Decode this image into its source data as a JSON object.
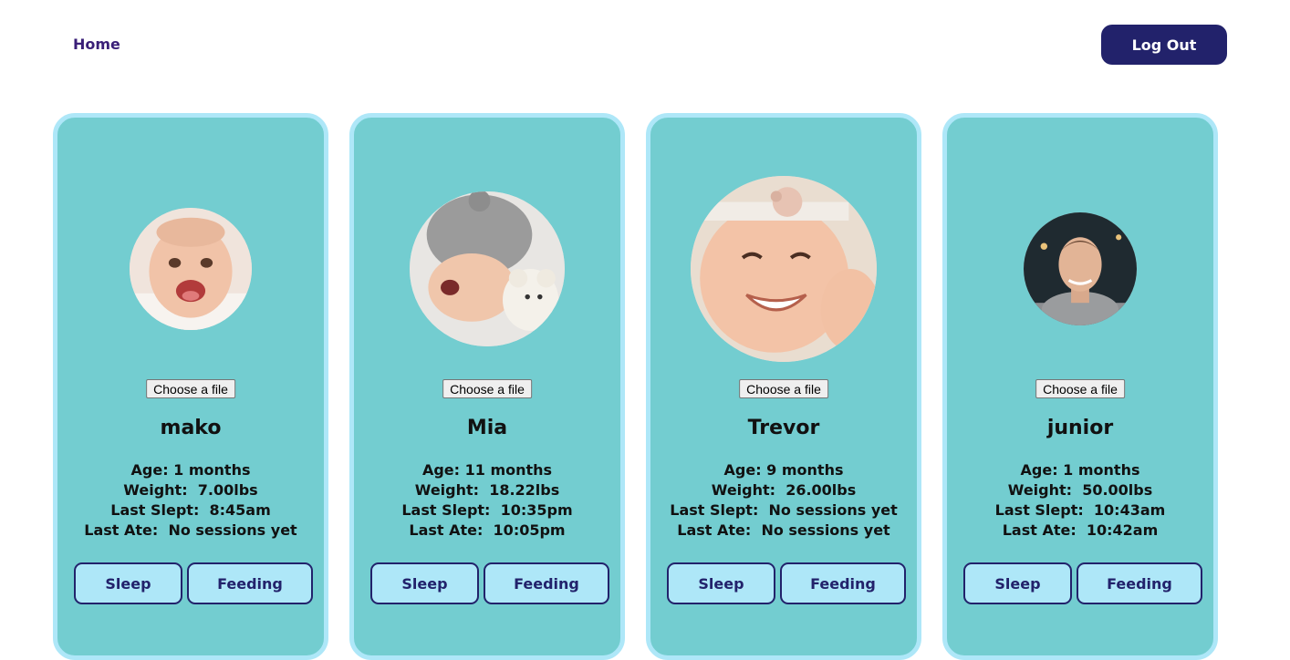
{
  "nav": {
    "home_label": "Home",
    "logout_label": "Log Out"
  },
  "file_button_label": "Choose a file",
  "actions": {
    "sleep_label": "Sleep",
    "feeding_label": "Feeding"
  },
  "babies": [
    {
      "name": "mako",
      "stats": [
        {
          "label": "Age:",
          "value": "1 months",
          "sep": " "
        },
        {
          "label": "Weight:",
          "value": "7.00lbs",
          "sep": "  "
        },
        {
          "label": "Last Slept:",
          "value": "8:45am",
          "sep": "  "
        },
        {
          "label": "Last Ate:",
          "value": "No sessions yet",
          "sep": "  "
        }
      ]
    },
    {
      "name": "Mia",
      "stats": [
        {
          "label": "Age:",
          "value": "11 months",
          "sep": " "
        },
        {
          "label": "Weight:",
          "value": "18.22lbs",
          "sep": "  "
        },
        {
          "label": "Last Slept:",
          "value": "10:35pm",
          "sep": "  "
        },
        {
          "label": "Last Ate:",
          "value": "10:05pm",
          "sep": "  "
        }
      ]
    },
    {
      "name": "Trevor",
      "stats": [
        {
          "label": "Age:",
          "value": "9 months",
          "sep": " "
        },
        {
          "label": "Weight:",
          "value": "26.00lbs",
          "sep": "  "
        },
        {
          "label": "Last Slept:",
          "value": "No sessions yet",
          "sep": "  "
        },
        {
          "label": "Last Ate:",
          "value": "No sessions yet",
          "sep": "  "
        }
      ]
    },
    {
      "name": "junior",
      "stats": [
        {
          "label": "Age:",
          "value": "1 months",
          "sep": " "
        },
        {
          "label": "Weight:",
          "value": "50.00lbs",
          "sep": "  "
        },
        {
          "label": "Last Slept:",
          "value": "10:43am",
          "sep": "  "
        },
        {
          "label": "Last Ate:",
          "value": "10:42am",
          "sep": "  "
        }
      ]
    }
  ]
}
